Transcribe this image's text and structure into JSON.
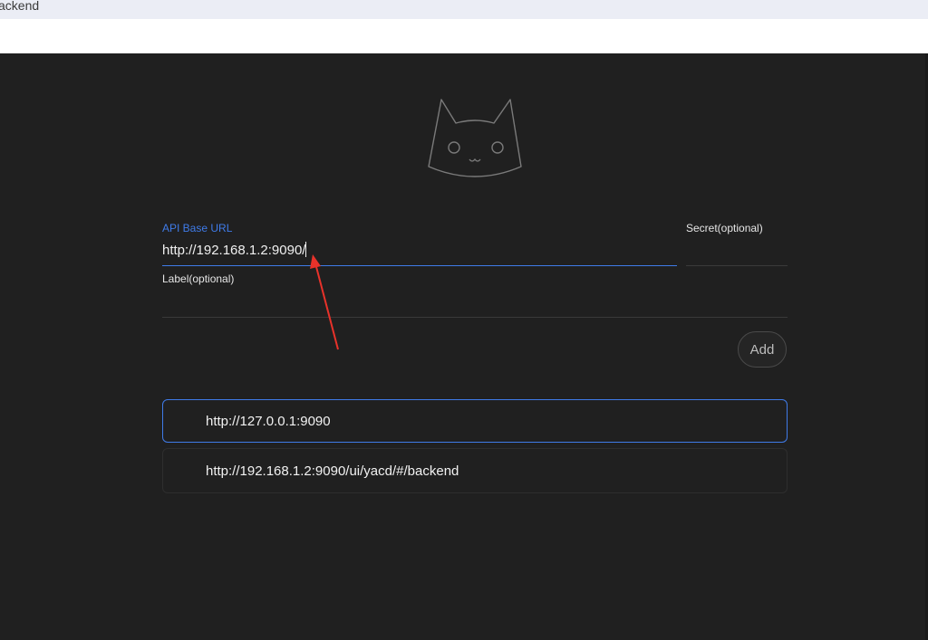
{
  "browser": {
    "tab_text": "ackend"
  },
  "form": {
    "api_base_url": {
      "label": "API Base URL",
      "value": "http://192.168.1.2:9090/"
    },
    "secret": {
      "label": "Secret(optional)",
      "value": ""
    },
    "label": {
      "label": "Label(optional)",
      "value": ""
    },
    "add_label": "Add"
  },
  "backends": [
    {
      "url": "http://127.0.0.1:9090",
      "selected": true
    },
    {
      "url": "http://192.168.1.2:9090/ui/yacd/#/backend",
      "selected": false
    }
  ],
  "icons": {
    "logo": "cat-logo-icon",
    "annotation": "red-arrow-annotation"
  },
  "colors": {
    "background": "#202020",
    "accent": "#3f7be8",
    "annotation": "#e8322a"
  }
}
